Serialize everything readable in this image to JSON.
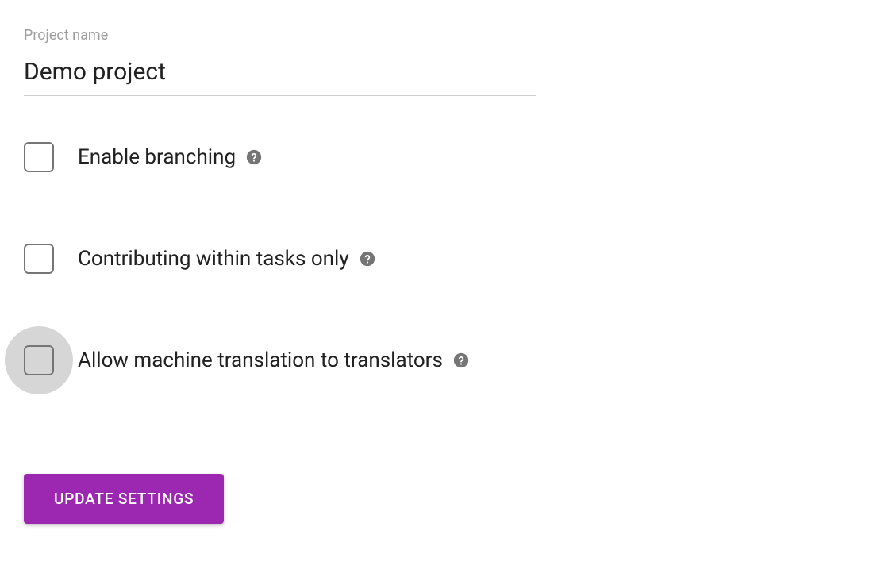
{
  "form": {
    "project_name_label": "Project name",
    "project_name_value": "Demo project"
  },
  "options": {
    "enable_branching": {
      "label": "Enable branching",
      "checked": false
    },
    "contributing_tasks": {
      "label": "Contributing within tasks only",
      "checked": false
    },
    "machine_translation": {
      "label": "Allow machine translation to translators",
      "checked": false,
      "highlighted": true
    }
  },
  "buttons": {
    "update": "UPDATE SETTINGS"
  },
  "colors": {
    "accent": "#9c27b0",
    "label_gray": "#9e9e9e",
    "text": "#212121",
    "help_icon": "#757575",
    "ripple": "#d6d6d6"
  }
}
